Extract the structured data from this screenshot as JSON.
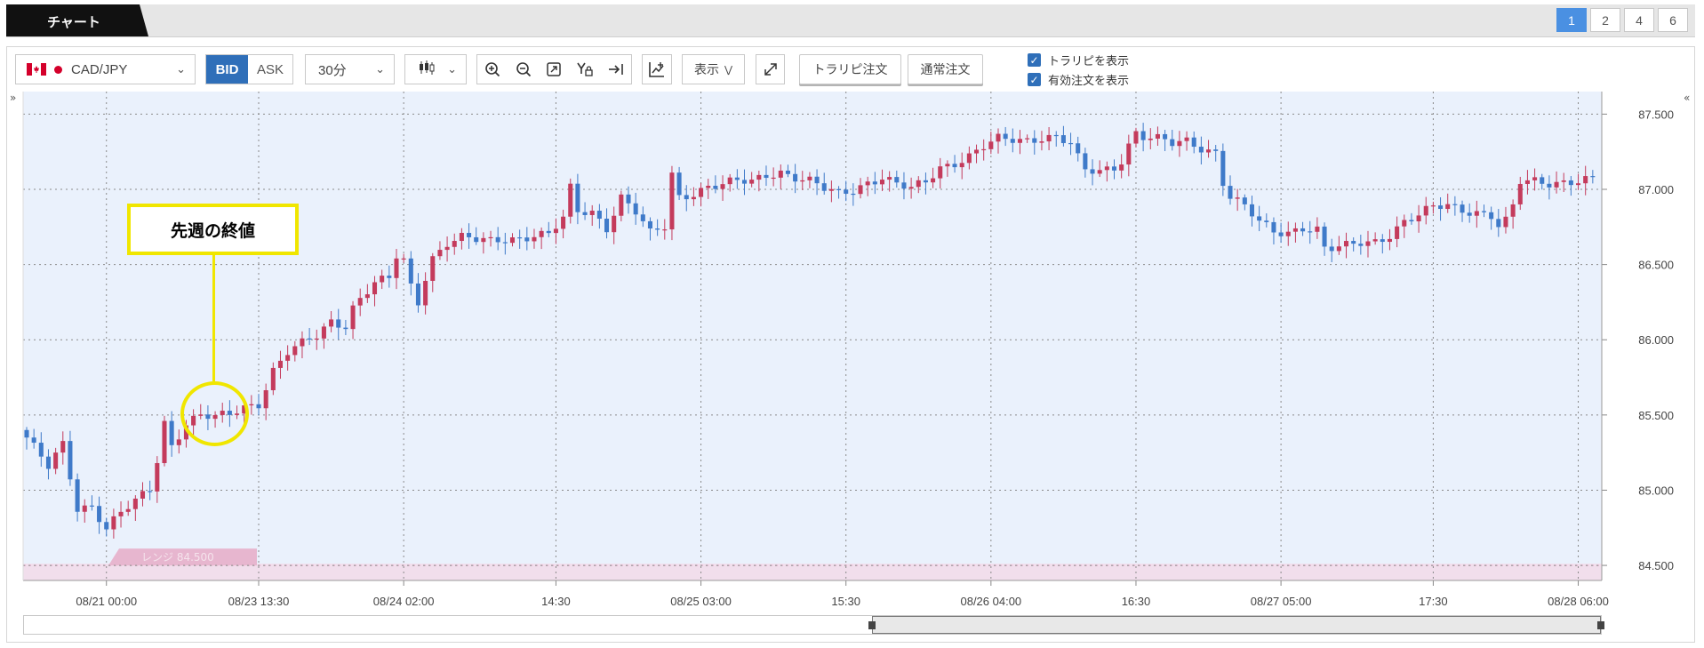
{
  "header": {
    "title": "チャート",
    "pages": [
      "1",
      "2",
      "4",
      "6"
    ],
    "active_page": "1"
  },
  "toolbar": {
    "pair": "CAD/JPY",
    "bid": "BID",
    "ask": "ASK",
    "interval": "30分",
    "display": "表示",
    "trap_order": "トラリピ注文",
    "normal_order": "通常注文",
    "show_trap": "トラリピを表示",
    "show_orders": "有効注文を表示"
  },
  "icons": [
    "zoom-in-icon",
    "zoom-out-icon",
    "fit-icon",
    "y-lock-icon",
    "scroll-end-icon",
    "draw-icon",
    "expand-icon",
    "candlestick-icon"
  ],
  "colors": {
    "up": "#c43b5c",
    "down": "#3f7ac9",
    "accent": "#2f6fb9",
    "callout": "#f0e600",
    "plot_bg": "#eaf1fc"
  },
  "annotation": {
    "label": "先週の終値"
  },
  "range_label": "レンジ 84.500",
  "chart_data": {
    "type": "candlestick",
    "y_ticks": [
      "87.500",
      "87.000",
      "86.500",
      "86.000",
      "85.500",
      "85.000",
      "84.500"
    ],
    "ylim": [
      84.4,
      87.65
    ],
    "x_ticks": [
      "08/21 00:00",
      "08/23 13:30",
      "08/24 02:00",
      "14:30",
      "08/25 03:00",
      "15:30",
      "08/26 04:00",
      "16:30",
      "08/27 05:00",
      "17:30",
      "08/28 06:00"
    ],
    "x_tick_index": [
      11,
      32,
      52,
      73,
      93,
      113,
      133,
      153,
      173,
      194,
      214
    ],
    "n_bars": 217,
    "close_path": [
      [
        0,
        85.35
      ],
      [
        3,
        85.15
      ],
      [
        5,
        85.3
      ],
      [
        7,
        84.88
      ],
      [
        9,
        84.9
      ],
      [
        11,
        84.75
      ],
      [
        13,
        84.85
      ],
      [
        15,
        84.92
      ],
      [
        17,
        85.0
      ],
      [
        18,
        85.2
      ],
      [
        19,
        85.45
      ],
      [
        20,
        85.3
      ],
      [
        22,
        85.45
      ],
      [
        24,
        85.5
      ],
      [
        26,
        85.48
      ],
      [
        28,
        85.5
      ],
      [
        30,
        85.55
      ],
      [
        32,
        85.58
      ],
      [
        34,
        85.8
      ],
      [
        36,
        85.92
      ],
      [
        38,
        85.97
      ],
      [
        40,
        86.02
      ],
      [
        42,
        86.12
      ],
      [
        44,
        86.1
      ],
      [
        45,
        86.22
      ],
      [
        46,
        86.28
      ],
      [
        48,
        86.38
      ],
      [
        50,
        86.4
      ],
      [
        51,
        86.55
      ],
      [
        52,
        86.52
      ],
      [
        53,
        86.35
      ],
      [
        54,
        86.25
      ],
      [
        55,
        86.42
      ],
      [
        56,
        86.55
      ],
      [
        58,
        86.65
      ],
      [
        60,
        86.68
      ],
      [
        62,
        86.66
      ],
      [
        64,
        86.65
      ],
      [
        66,
        86.67
      ],
      [
        68,
        86.68
      ],
      [
        70,
        86.7
      ],
      [
        72,
        86.7
      ],
      [
        74,
        86.8
      ],
      [
        75,
        87.0
      ],
      [
        76,
        86.85
      ],
      [
        78,
        86.85
      ],
      [
        80,
        86.75
      ],
      [
        82,
        86.95
      ],
      [
        84,
        86.85
      ],
      [
        86,
        86.7
      ],
      [
        88,
        86.75
      ],
      [
        89,
        87.1
      ],
      [
        90,
        86.95
      ],
      [
        92,
        86.98
      ],
      [
        94,
        87.02
      ],
      [
        96,
        87.03
      ],
      [
        98,
        87.05
      ],
      [
        100,
        87.05
      ],
      [
        102,
        87.1
      ],
      [
        104,
        87.12
      ],
      [
        106,
        87.08
      ],
      [
        108,
        87.05
      ],
      [
        110,
        87.0
      ],
      [
        112,
        86.97
      ],
      [
        114,
        87.0
      ],
      [
        116,
        87.05
      ],
      [
        118,
        87.08
      ],
      [
        120,
        87.03
      ],
      [
        122,
        87.0
      ],
      [
        124,
        87.05
      ],
      [
        126,
        87.15
      ],
      [
        128,
        87.18
      ],
      [
        130,
        87.22
      ],
      [
        132,
        87.28
      ],
      [
        134,
        87.33
      ],
      [
        136,
        87.33
      ],
      [
        138,
        87.33
      ],
      [
        140,
        87.35
      ],
      [
        142,
        87.35
      ],
      [
        144,
        87.3
      ],
      [
        145,
        87.2
      ],
      [
        146,
        87.12
      ],
      [
        148,
        87.12
      ],
      [
        150,
        87.15
      ],
      [
        151,
        87.2
      ],
      [
        152,
        87.3
      ],
      [
        153,
        87.38
      ],
      [
        154,
        87.35
      ],
      [
        156,
        87.33
      ],
      [
        158,
        87.3
      ],
      [
        160,
        87.32
      ],
      [
        162,
        87.28
      ],
      [
        164,
        87.25
      ],
      [
        165,
        87.05
      ],
      [
        166,
        86.95
      ],
      [
        168,
        86.88
      ],
      [
        170,
        86.78
      ],
      [
        172,
        86.72
      ],
      [
        174,
        86.72
      ],
      [
        176,
        86.75
      ],
      [
        178,
        86.73
      ],
      [
        179,
        86.6
      ],
      [
        180,
        86.6
      ],
      [
        182,
        86.62
      ],
      [
        184,
        86.65
      ],
      [
        186,
        86.66
      ],
      [
        188,
        86.7
      ],
      [
        190,
        86.78
      ],
      [
        192,
        86.82
      ],
      [
        194,
        86.88
      ],
      [
        196,
        86.9
      ],
      [
        198,
        86.87
      ],
      [
        200,
        86.85
      ],
      [
        202,
        86.82
      ],
      [
        203,
        86.75
      ],
      [
        204,
        86.78
      ],
      [
        205,
        86.88
      ],
      [
        206,
        87.05
      ],
      [
        208,
        87.06
      ],
      [
        210,
        87.05
      ],
      [
        212,
        87.05
      ],
      [
        214,
        87.05
      ],
      [
        216,
        87.06
      ]
    ],
    "grid": true,
    "y_axis_position": "right",
    "annotation_bar_index": 28
  }
}
